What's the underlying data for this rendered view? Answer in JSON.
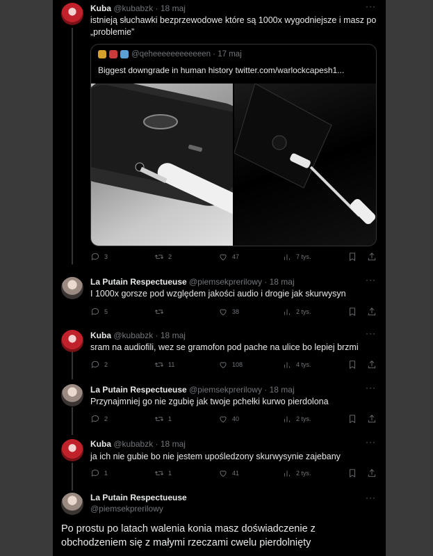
{
  "tweets": [
    {
      "name": "Kuba",
      "meta": "@kubabzk · 18 maj",
      "text": "istnieją słuchawki bezprzewodowe które są 1000x wygodniejsze i masz po „problemie”",
      "quote": {
        "meta": "@qeheeeeeeeeeeeen · 17 maj",
        "text": "Biggest downgrade in human history  twitter.com/warlockcapesh1..."
      },
      "stats": {
        "replies": "3",
        "retweets": "2",
        "likes": "47",
        "views": "7 tys."
      }
    },
    {
      "name": "La Putain Respectueuse",
      "meta": "@piemsekprerilowy · 18 maj",
      "text": "I 1000x gorsze pod względem jakości audio i drogie jak skurwysyn",
      "stats": {
        "replies": "5",
        "retweets": "",
        "likes": "38",
        "views": "2 tys."
      }
    },
    {
      "name": "Kuba",
      "meta": "@kubabzk · 18 maj",
      "text": "sram na audiofili, wez se gramofon pod pache na ulice bo lepiej brzmi",
      "stats": {
        "replies": "2",
        "retweets": "11",
        "likes": "108",
        "views": "4 tys."
      }
    },
    {
      "name": "La Putain Respectueuse",
      "meta": "@piemsekprerilowy · 18 maj",
      "text": "Przynajmniej go nie zgubię jak twoje pchełki kurwo pierdolona",
      "stats": {
        "replies": "2",
        "retweets": "1",
        "likes": "40",
        "views": "2 tys."
      }
    },
    {
      "name": "Kuba",
      "meta": "@kubabzk · 18 maj",
      "text": "ja ich nie gubie bo nie jestem upośledzony skurwysynie zajebany",
      "stats": {
        "replies": "1",
        "retweets": "1",
        "likes": "41",
        "views": "2 tys."
      }
    }
  ],
  "main_tweet": {
    "name": "La Putain Respectueuse",
    "handle": "@piemsekprerilowy",
    "text": "Po prostu po latach walenia konia masz doświadczenie z obchodzeniem się z małymi rzeczami cwelu pierdolnięty"
  },
  "more_glyph": "···"
}
